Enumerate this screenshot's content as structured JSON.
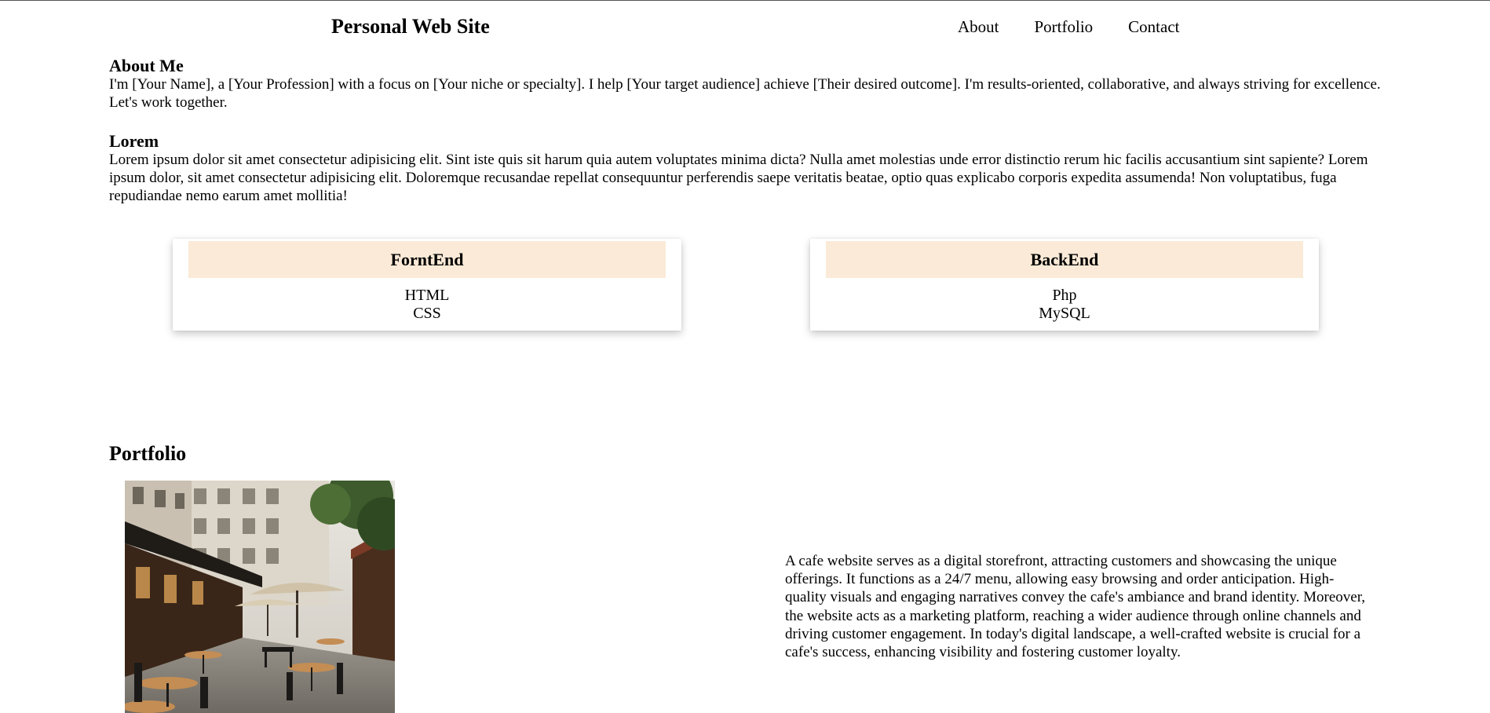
{
  "header": {
    "title": "Personal Web Site",
    "nav": [
      "About",
      "Portfolio",
      "Contact"
    ]
  },
  "about": {
    "heading": "About Me",
    "text": "I'm [Your Name], a [Your Profession] with a focus on [Your niche or specialty]. I help [Your target audience] achieve [Their desired outcome]. I'm results-oriented, collaborative, and always striving for excellence. Let's work together."
  },
  "lorem": {
    "heading": "Lorem",
    "text": "Lorem ipsum dolor sit amet consectetur adipisicing elit. Sint iste quis sit harum quia autem voluptates minima dicta? Nulla amet molestias unde error distinctio rerum hic facilis accusantium sint sapiente? Lorem ipsum dolor, sit amet consectetur adipisicing elit. Doloremque recusandae repellat consequuntur perferendis saepe veritatis beatae, optio quas explicabo corporis expedita assumenda! Non voluptatibus, fuga repudiandae nemo earum amet mollitia!"
  },
  "skills": [
    {
      "title": "ForntEnd",
      "items": [
        "HTML",
        "CSS"
      ]
    },
    {
      "title": "BackEnd",
      "items": [
        "Php",
        "MySQL"
      ]
    }
  ],
  "portfolio": {
    "heading": "Portfolio",
    "description": "A cafe website serves as a digital storefront, attracting customers and showcasing the unique offerings. It functions as a 24/7 menu, allowing easy browsing and order anticipation. High-quality visuals and engaging narratives convey the cafe's ambiance and brand identity. Moreover, the website acts as a marketing platform, reaching a wider audience through online channels and driving customer engagement. In today's digital landscape, a well-crafted website is crucial for a cafe's success, enhancing visibility and fostering customer loyalty."
  },
  "colors": {
    "card_header_bg": "#faead7",
    "text": "#000000",
    "background": "#ffffff"
  }
}
